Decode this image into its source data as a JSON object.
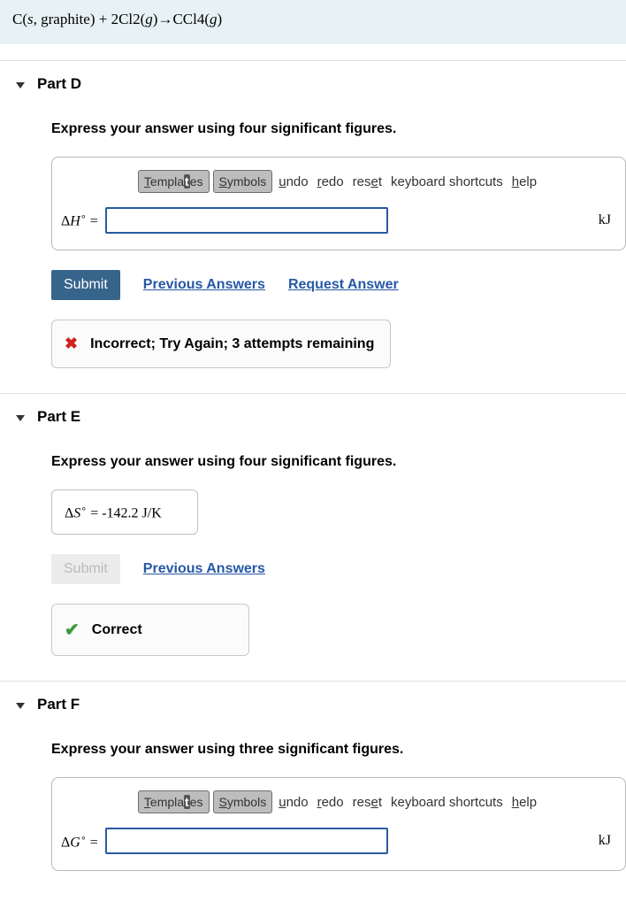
{
  "equation": "C(s, graphite) + 2Cl2(g)→CCl4(g)",
  "toolbar": {
    "templates": "Templates",
    "symbols": "Symbols",
    "undo": "undo",
    "redo": "redo",
    "reset": "reset",
    "keyboard_shortcuts": "keyboard shortcuts",
    "help": "help"
  },
  "buttons": {
    "submit": "Submit",
    "previous_answers": "Previous Answers",
    "request_answer": "Request Answer"
  },
  "partD": {
    "title": "Part D",
    "instructions": "Express your answer using four significant figures.",
    "var_prefix": "Δ",
    "var_letter": "H",
    "var_sup": "∘",
    "equals": " =",
    "value": "",
    "unit": "kJ",
    "feedback": "Incorrect; Try Again; 3 attempts remaining"
  },
  "partE": {
    "title": "Part E",
    "instructions": "Express your answer using four significant figures.",
    "var_prefix": "Δ",
    "var_letter": "S",
    "var_sup": "∘",
    "equals": " = ",
    "value": "-142.2",
    "unit": "J/K",
    "feedback": "Correct"
  },
  "partF": {
    "title": "Part F",
    "instructions": "Express your answer using three significant figures.",
    "var_prefix": "Δ",
    "var_letter": "G",
    "var_sup": "∘",
    "equals": " =",
    "value": "",
    "unit": "kJ"
  }
}
